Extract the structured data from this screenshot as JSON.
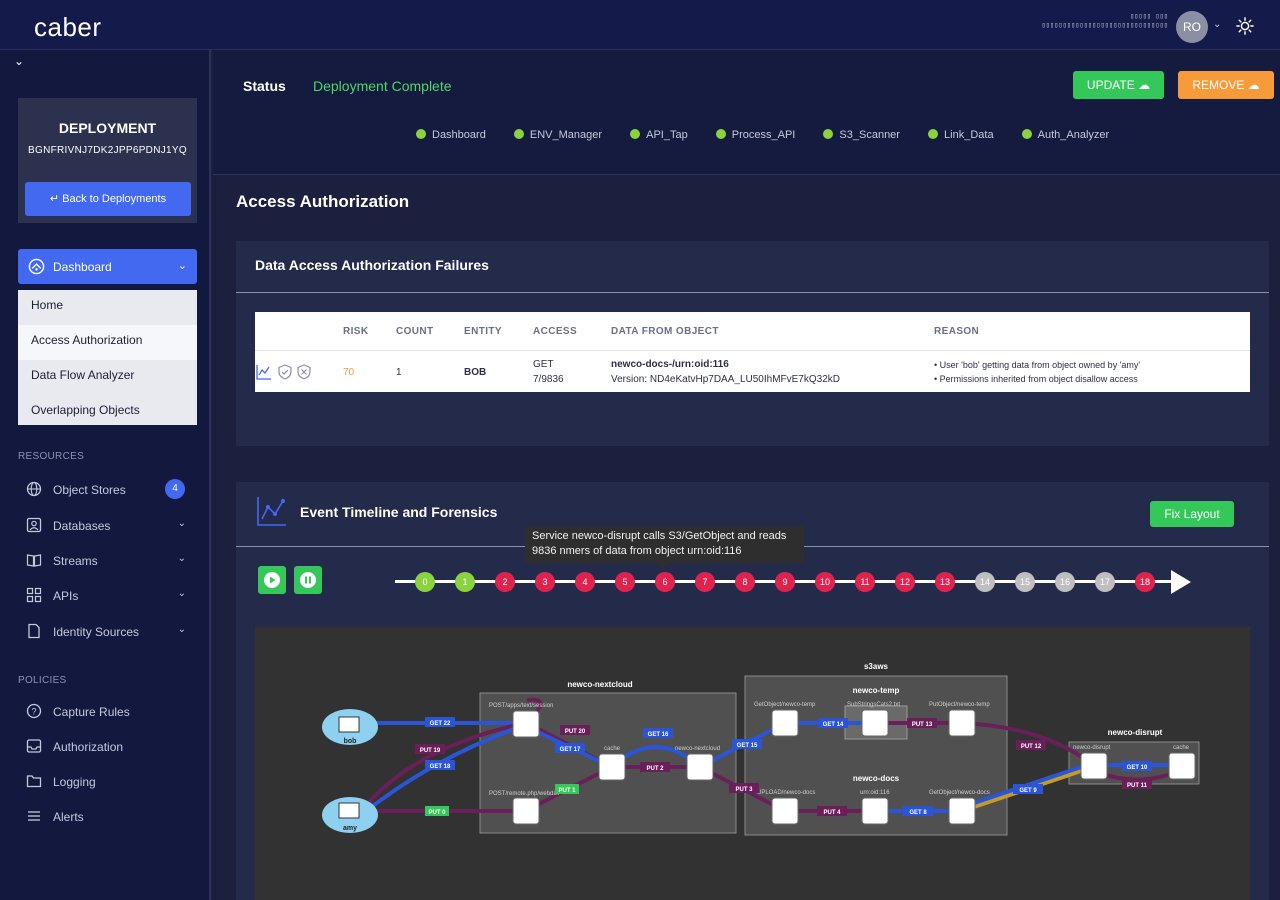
{
  "header": {
    "logo": "caber",
    "top_garble_1": "▯▯▯▯▯ ▯▯▯",
    "top_garble_2": "▯▯▯▯▯▯▯▯▯▯▯▯▯▯▯▯▯▯▯▯▯▯▯▯▯▯▯▯▯▯",
    "avatar_initials": "RO"
  },
  "sidebar": {
    "deployment_title": "DEPLOYMENT",
    "deployment_id": "BGNFRIVNJ7DK2JPP6PDNJ1YQ",
    "back_label": "Back to Deployments",
    "dashboard_label": "Dashboard",
    "dashboard_items": [
      "Home",
      "Access Authorization",
      "Data Flow Analyzer",
      "Overlapping Objects"
    ],
    "resources_label": "RESOURCES",
    "resources": [
      {
        "label": "Object Stores",
        "icon": "globe-icon",
        "badge": "4"
      },
      {
        "label": "Databases",
        "icon": "database-icon"
      },
      {
        "label": "Streams",
        "icon": "book-icon"
      },
      {
        "label": "APIs",
        "icon": "grid-icon"
      },
      {
        "label": "Identity Sources",
        "icon": "document-icon"
      }
    ],
    "policies_label": "POLICIES",
    "policies": [
      {
        "label": "Capture Rules",
        "icon": "help-circle-icon"
      },
      {
        "label": "Authorization",
        "icon": "inbox-icon"
      },
      {
        "label": "Logging",
        "icon": "folder-icon"
      },
      {
        "label": "Alerts",
        "icon": "list-icon"
      }
    ]
  },
  "status": {
    "label": "Status",
    "value": "Deployment Complete",
    "update_label": "UPDATE",
    "remove_label": "REMOVE",
    "services": [
      "Dashboard",
      "ENV_Manager",
      "API_Tap",
      "Process_API",
      "S3_Scanner",
      "Link_Data",
      "Auth_Analyzer"
    ]
  },
  "page_title": "Access Authorization",
  "failures": {
    "title": "Data Access Authorization Failures",
    "columns": [
      "RISK",
      "COUNT",
      "ENTITY",
      "ACCESS",
      "DATA FROM OBJECT",
      "REASON"
    ],
    "row": {
      "risk": "70",
      "count": "1",
      "entity": "BOB",
      "access_1": "GET",
      "access_2": "7/9836",
      "object_1": "newco-docs-/urn:oid:116",
      "object_2": "Version: ND4eKatvHp7DAA_LU50IhMFvE7kQ32kD",
      "reason_1": "• User 'bob' getting data from object owned by 'amy'",
      "reason_2": "• Permissions inherited from object disallow access"
    }
  },
  "timeline": {
    "title": "Event Timeline and Forensics",
    "fix_layout_label": "Fix Layout",
    "tooltip_1": "Service newco-disrupt calls S3/GetObject and reads",
    "tooltip_2": "9836 nmers of data from object urn:oid:116",
    "steps": [
      {
        "n": "0",
        "state": "green"
      },
      {
        "n": "1",
        "state": "green"
      },
      {
        "n": "2",
        "state": "red"
      },
      {
        "n": "3",
        "state": "red"
      },
      {
        "n": "4",
        "state": "red"
      },
      {
        "n": "5",
        "state": "red"
      },
      {
        "n": "6",
        "state": "red"
      },
      {
        "n": "7",
        "state": "red"
      },
      {
        "n": "8",
        "state": "red"
      },
      {
        "n": "9",
        "state": "red"
      },
      {
        "n": "10",
        "state": "red"
      },
      {
        "n": "11",
        "state": "red"
      },
      {
        "n": "12",
        "state": "red"
      },
      {
        "n": "13",
        "state": "red"
      },
      {
        "n": "14",
        "state": "grey"
      },
      {
        "n": "15",
        "state": "grey"
      },
      {
        "n": "16",
        "state": "grey"
      },
      {
        "n": "17",
        "state": "grey"
      },
      {
        "n": "18",
        "state": "red"
      }
    ]
  },
  "graph": {
    "groups": {
      "nextcloud": "newco-nextcloud",
      "s3aws": "s3aws",
      "temp": "newco-temp",
      "docs": "newco-docs",
      "disrupt": "newco-disrupt"
    },
    "actors": {
      "bob": "bob",
      "amy": "amy"
    },
    "nodes": {
      "post_session": "POST/apps/text/session",
      "cache": "cache",
      "nextcloud": "newco-nextcloud",
      "post_webdav": "POST/remote.php/webdav",
      "getobj_temp": "GetObject/newco-temp",
      "substrings": "SubStringsCats2.txt",
      "putobj_temp": "PutObject/newco-temp",
      "upload_docs": "UPLOAD/newco-docs",
      "urn": "urn:oid:116",
      "getobj_docs": "GetObject/newco-docs",
      "disrupt": "newco-disrupt",
      "disrupt_cache": "cache"
    },
    "edges": {
      "get22": "GET 22",
      "put19": "PUT 19",
      "get18": "GET 18",
      "put0": "PUT 0",
      "put1": "PUT 1",
      "put20": "PUT 20",
      "get17": "GET 17",
      "get16": "GET 16",
      "put2": "PUT 2",
      "get15": "GET 15",
      "get14": "GET 14",
      "put13": "PUT 13",
      "put3": "PUT 3",
      "put4": "PUT 4",
      "get8": "GET 8",
      "get9": "GET 9",
      "put12": "PUT 12",
      "get10": "GET 10",
      "put11": "PUT 11"
    }
  },
  "colors": {
    "accent_blue": "#4269f0",
    "success_green": "#34c759",
    "warning_orange": "#f79a3a",
    "risk_orange": "#f79a3a",
    "fail_red": "#e0234e",
    "put_purple": "#6b1f5a",
    "get_blue": "#2a55d6"
  }
}
